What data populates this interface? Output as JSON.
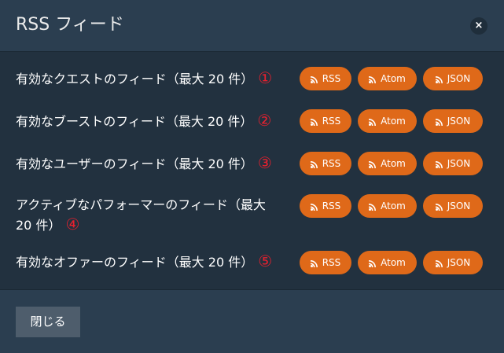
{
  "modal": {
    "title": "RSS フィード",
    "close_icon": "×",
    "close_button": "閉じる"
  },
  "feeds": [
    {
      "label": "有効なクエストのフィード（最大 20 件）",
      "mark": "①"
    },
    {
      "label": "有効なブーストのフィード（最大 20 件）",
      "mark": "②"
    },
    {
      "label": "有効なユーザーのフィード（最大 20 件）",
      "mark": "③"
    },
    {
      "label_line1": "アクティブなパフォーマーのフィード（最大",
      "label_line2": "20 件）",
      "mark": "④"
    },
    {
      "label": "有効なオファーのフィード（最大 20 件）",
      "mark": "⑤"
    }
  ],
  "buttons": {
    "rss": "RSS",
    "atom": "Atom",
    "json": "JSON",
    "icon": "rss-feed-icon"
  },
  "colors": {
    "accent_orange": "#df6919",
    "marker_red": "#e8202e",
    "background": "#2b3e50"
  }
}
